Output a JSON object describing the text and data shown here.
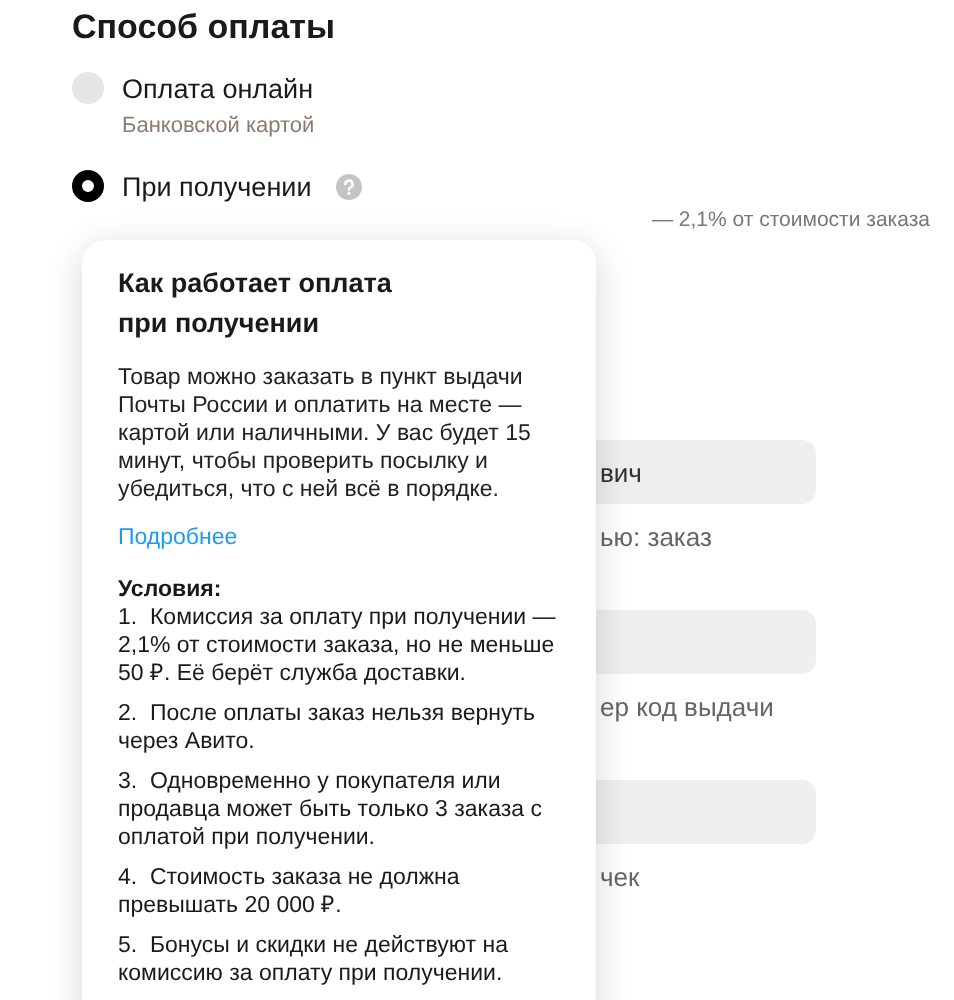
{
  "section_title": "Способ оплаты",
  "payment_options": [
    {
      "label": "Оплата онлайн",
      "subtitle": "Банковской картой",
      "selected": false,
      "help": false
    },
    {
      "label": "При получении",
      "subtitle": "— 2,1% от стоимости заказа",
      "selected": true,
      "help": true
    }
  ],
  "form_behind": {
    "fields": [
      {
        "value": "вич",
        "hint": "ью: заказ"
      },
      {
        "hint": "ер код выдачи"
      },
      {
        "hint": "чек"
      }
    ]
  },
  "popover": {
    "title": "Как работает оплата при получении",
    "text": "Товар можно заказать в пункт выдачи Почты России и оплатить на месте — картой или наличными. У вас будет 15 минут, чтобы проверить посылку и убедиться, что с ней всё в порядке.",
    "link": "Подробнее",
    "conditions_title": "Условия:",
    "conditions": [
      "1.  Комиссия за оплату при получении — 2,1% от стоимости заказа, но не меньше 50 ₽. Её берёт служба доставки.",
      "2.  После оплаты заказ нельзя вернуть через Авито.",
      "3.  Одновременно у покупателя или продавца может быть только 3 заказа с оплатой при получении.",
      "4.  Стоимость заказа не должна превышать 20 000 ₽.",
      "5.  Бонусы и скидки не действуют на комиссию за оплату при получении."
    ]
  }
}
